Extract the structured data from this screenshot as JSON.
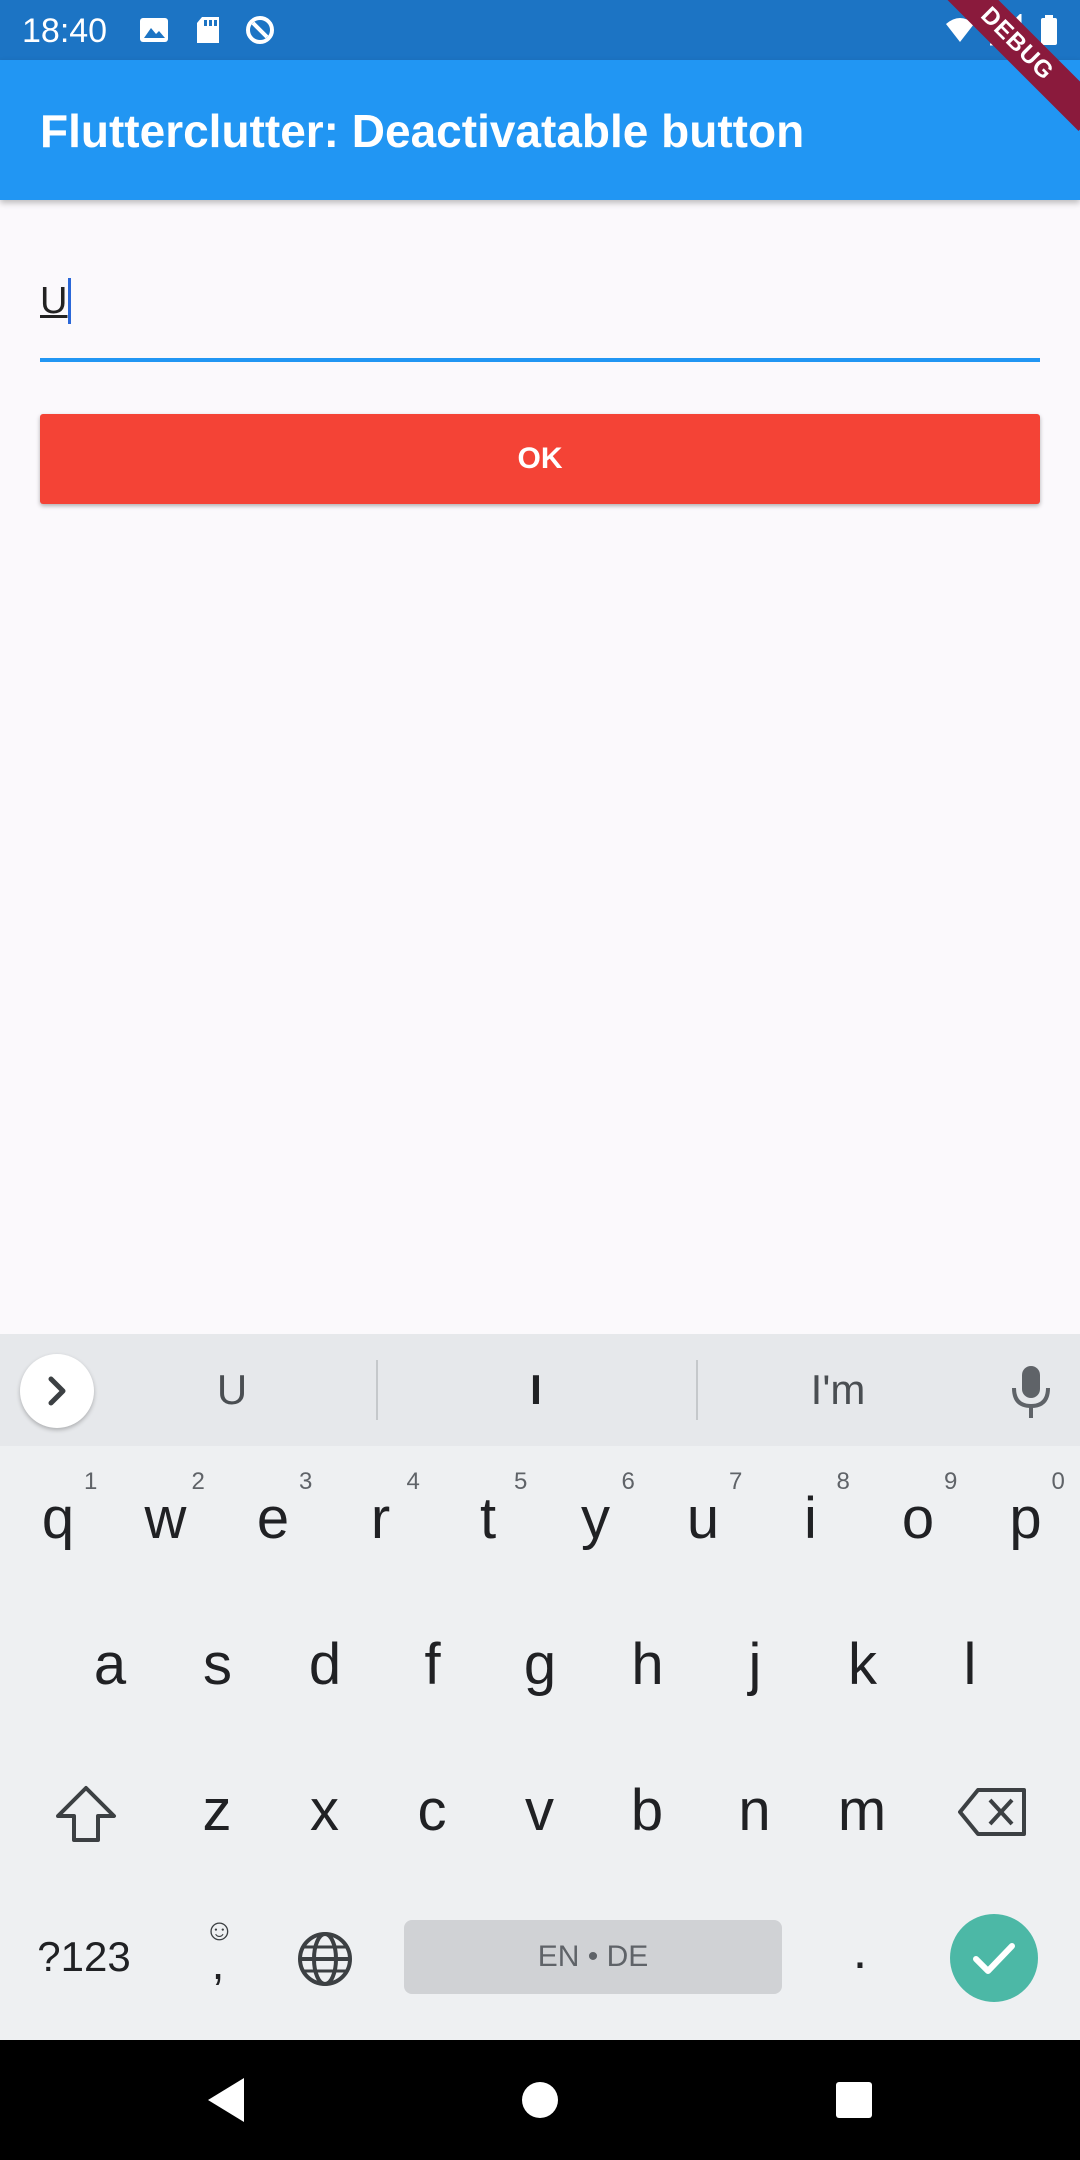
{
  "status_bar": {
    "time": "18:40",
    "debug_label": "DEBUG"
  },
  "app_bar": {
    "title": "Flutterclutter: Deactivatable button"
  },
  "form": {
    "text_value": "U",
    "button_label": "OK"
  },
  "colors": {
    "app_bar": "#2196f3",
    "status_bar": "#1c74c4",
    "button": "#f44336",
    "accent": "#2196f3"
  },
  "keyboard": {
    "suggestions": [
      "U",
      "I",
      "I'm"
    ],
    "row1": [
      {
        "key": "q",
        "hint": "1"
      },
      {
        "key": "w",
        "hint": "2"
      },
      {
        "key": "e",
        "hint": "3"
      },
      {
        "key": "r",
        "hint": "4"
      },
      {
        "key": "t",
        "hint": "5"
      },
      {
        "key": "y",
        "hint": "6"
      },
      {
        "key": "u",
        "hint": "7"
      },
      {
        "key": "i",
        "hint": "8"
      },
      {
        "key": "o",
        "hint": "9"
      },
      {
        "key": "p",
        "hint": "0"
      }
    ],
    "row2": [
      "a",
      "s",
      "d",
      "f",
      "g",
      "h",
      "j",
      "k",
      "l"
    ],
    "row3": [
      "z",
      "x",
      "c",
      "v",
      "b",
      "n",
      "m"
    ],
    "symbols_label": "?123",
    "comma": ",",
    "emoji_hint": "☺",
    "space_label": "EN • DE",
    "period": "."
  }
}
